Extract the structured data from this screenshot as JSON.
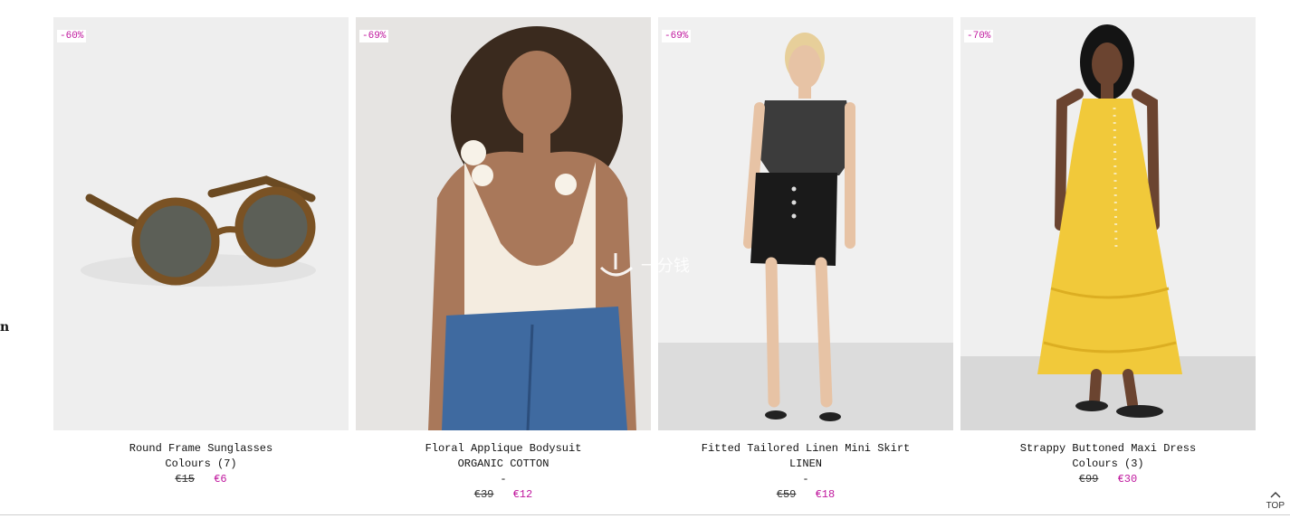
{
  "edge_char": "n",
  "products": [
    {
      "badge": "-60%",
      "name": "Round Frame Sunglasses",
      "sub": "Colours (7)",
      "dash": "",
      "old_price": "€15",
      "new_price": "€6"
    },
    {
      "badge": "-69%",
      "name": "Floral Applique Bodysuit",
      "sub": "ORGANIC COTTON",
      "dash": "-",
      "old_price": "€39",
      "new_price": "€12"
    },
    {
      "badge": "-69%",
      "name": "Fitted Tailored Linen Mini Skirt",
      "sub": "LINEN",
      "dash": "-",
      "old_price": "€59",
      "new_price": "€18"
    },
    {
      "badge": "-70%",
      "name": "Strappy Buttoned Maxi Dress",
      "sub": "Colours (3)",
      "dash": "",
      "old_price": "€99",
      "new_price": "€30"
    }
  ],
  "top_label": "TOP",
  "watermark": "一分钱",
  "colors": {
    "sale": "#c0189e",
    "dress_yellow": "#f1c93a",
    "skirt_black": "#1a1a1a"
  }
}
